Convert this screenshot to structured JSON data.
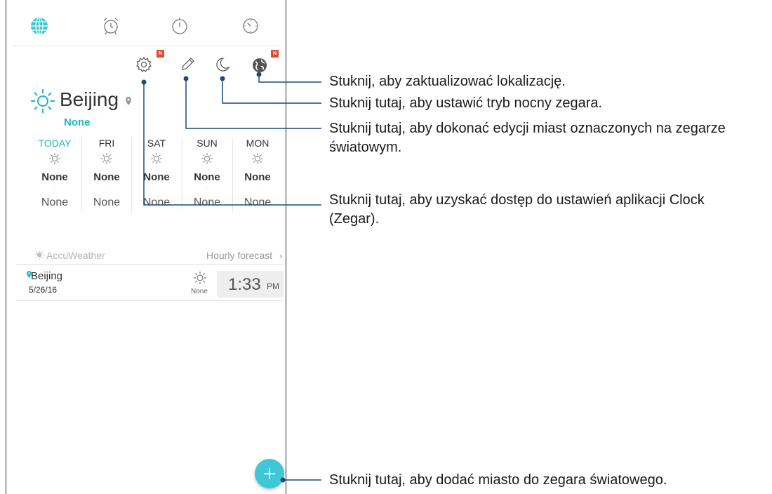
{
  "tabs": [
    {
      "name": "world-clock",
      "icon": "globe-icon",
      "active": true
    },
    {
      "name": "alarm",
      "icon": "alarm-clock-icon"
    },
    {
      "name": "stopwatch",
      "icon": "stopwatch-icon"
    },
    {
      "name": "timer",
      "icon": "timer-icon"
    }
  ],
  "toolbar": {
    "settings_icon": "gear-icon",
    "edit_icon": "pencil-icon",
    "night_icon": "moon-icon",
    "location_icon": "globe-location-icon",
    "new_badge": "N"
  },
  "city": {
    "name": "Beijing",
    "condition": "None",
    "weather_icon": "sun-icon"
  },
  "forecast": [
    {
      "day": "TODAY",
      "condition": "None",
      "temp": "None"
    },
    {
      "day": "FRI",
      "condition": "None",
      "temp": "None"
    },
    {
      "day": "SAT",
      "condition": "None",
      "temp": "None"
    },
    {
      "day": "SUN",
      "condition": "None",
      "temp": "None"
    },
    {
      "day": "MON",
      "condition": "None",
      "temp": "None"
    }
  ],
  "accuweather": {
    "label": "AccuWeather",
    "hourly_label": "Hourly forecast",
    "hourly_arrow": "›"
  },
  "city_row": {
    "name": "Beijing",
    "date": "5/26/16",
    "condition": "None",
    "time": "1:33",
    "ampm": "PM"
  },
  "callouts": {
    "location": "Stuknij, aby zaktualizować lokalizację.",
    "night": "Stuknij tutaj, aby ustawić tryb nocny zegara.",
    "edit_line1": "Stuknij tutaj, aby dokonać edycji miast oznaczonych na zegarze",
    "edit_line2": "światowym.",
    "settings_line1": "Stuknij tutaj, aby uzyskać dostęp do ustawień aplikacji Clock",
    "settings_line2": "(Zegar).",
    "add_city": "Stuknij tutaj, aby dodać miasto do zegara światowego."
  },
  "colors": {
    "accent": "#22b5c4",
    "fab": "#3ec7d4",
    "badge": "#e04a2e",
    "callout_line": "#1a4a7a"
  }
}
